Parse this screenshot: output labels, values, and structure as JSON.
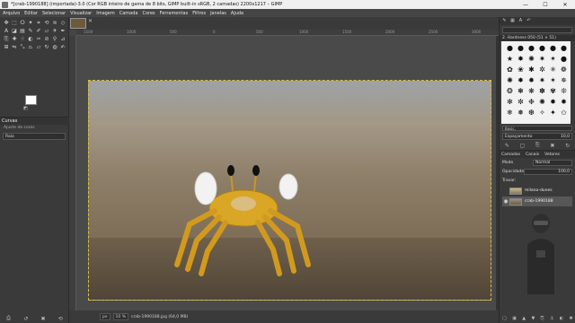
{
  "window": {
    "title": "*[crab-1990188] (importada)-3.0 (Cor RGB inteiro de gama de 8 bits, GIMP built-in sRGB, 2 camadas) 2200x1217 – GIMP",
    "minimize": "—",
    "maximize": "☐",
    "close": "✕"
  },
  "menu": [
    "Arquivo",
    "Editar",
    "Selecionar",
    "Visualizar",
    "Imagem",
    "Camada",
    "Cores",
    "Ferramentas",
    "Filtros",
    "Janelas",
    "Ajuda"
  ],
  "toolbox": {
    "tools": [
      {
        "icon": "move-icon",
        "glyph": "✥"
      },
      {
        "icon": "rect-select-icon",
        "glyph": "⬚"
      },
      {
        "icon": "lasso-icon",
        "glyph": "ⵔ"
      },
      {
        "icon": "fuzzy-select-icon",
        "glyph": "✦"
      },
      {
        "icon": "crop-icon",
        "glyph": "⌗"
      },
      {
        "icon": "unified-transform-icon",
        "glyph": "⟲"
      },
      {
        "icon": "warp-icon",
        "glyph": "≋"
      },
      {
        "icon": "cage-icon",
        "glyph": "◇"
      },
      {
        "icon": "text-icon",
        "glyph": "A"
      },
      {
        "icon": "bucket-icon",
        "glyph": "◪"
      },
      {
        "icon": "gradient-icon",
        "glyph": "▤"
      },
      {
        "icon": "pencil-icon",
        "glyph": "✎"
      },
      {
        "icon": "paintbrush-icon",
        "glyph": "✐"
      },
      {
        "icon": "eraser-icon",
        "glyph": "▱"
      },
      {
        "icon": "airbrush-icon",
        "glyph": "✈"
      },
      {
        "icon": "ink-icon",
        "glyph": "✒"
      },
      {
        "icon": "clone-icon",
        "glyph": "⎘"
      },
      {
        "icon": "heal-icon",
        "glyph": "✚"
      },
      {
        "icon": "smudge-icon",
        "glyph": "☝"
      },
      {
        "icon": "dodge-icon",
        "glyph": "◐"
      },
      {
        "icon": "paths-icon",
        "glyph": "✑"
      },
      {
        "icon": "color-picker-icon",
        "glyph": "⊘"
      },
      {
        "icon": "zoom-icon",
        "glyph": "⚲"
      },
      {
        "icon": "measure-icon",
        "glyph": "⊿"
      },
      {
        "icon": "align-icon",
        "glyph": "⊞"
      },
      {
        "icon": "flip-icon",
        "glyph": "⇋"
      },
      {
        "icon": "scale-icon",
        "glyph": "⤡"
      },
      {
        "icon": "perspective-icon",
        "glyph": "⏢"
      },
      {
        "icon": "shear-icon",
        "glyph": "▱"
      },
      {
        "icon": "rotate-icon",
        "glyph": "↻"
      },
      {
        "icon": "blur-icon",
        "glyph": "◍"
      },
      {
        "icon": "mypaint-icon",
        "glyph": "✍"
      }
    ],
    "curves_title": "Curvas",
    "curves_subtitle": "Ajuste de cores",
    "curves_preset": "Raio"
  },
  "canvas": {
    "ruler_marks": [
      "1500",
      "1000",
      "500",
      "0",
      "500",
      "1000",
      "1500",
      "2000",
      "2500",
      "3000"
    ],
    "status_unit": "px",
    "status_zoom": "10 %",
    "status_text": "crab-1990188.jpg (64,0 MB)"
  },
  "dock": {
    "brush_filter": "",
    "brush_name": "2. Hardness 050 (51 × 51)",
    "brush_tag": "Basic,",
    "spacing_label": "Espaçamento",
    "spacing_value": "10,0",
    "layer_tabs": [
      "Camadas",
      "Canais",
      "Vetores"
    ],
    "mode_label": "Modo",
    "mode_value": "Normal",
    "opacity_label": "Opacidade",
    "opacity_value": "100,0",
    "lock_label": "Travar:",
    "layers": [
      {
        "name": "milano-dunes",
        "visible": false,
        "selected": false
      },
      {
        "name": "crab-1990188",
        "visible": true,
        "selected": true
      }
    ]
  },
  "colors": {
    "foreground": "#ffffff",
    "background": "#000000",
    "selection": "#d4c040"
  }
}
